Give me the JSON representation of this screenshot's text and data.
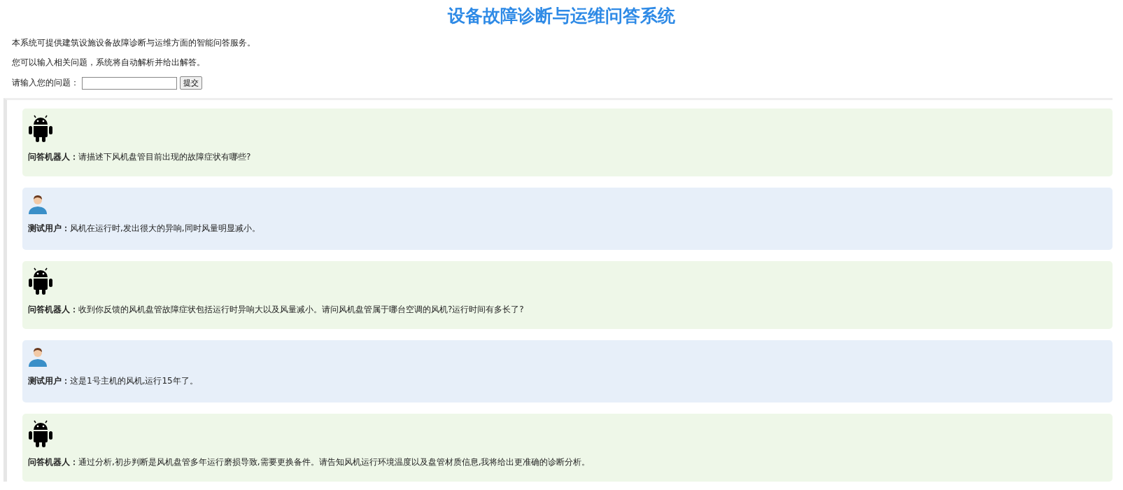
{
  "title": "设备故障诊断与运维问答系统",
  "intro": [
    "本系统可提供建筑设施设备故障诊断与运维方面的智能问答服务。",
    "您可以输入相关问题，系统将自动解析并给出解答。"
  ],
  "question_form": {
    "label": "请输入您的问题：",
    "submit": "提交"
  },
  "messages": [
    {
      "kind": "bot",
      "text": "**问答机器人：**请描述下风机盘管目前出现的故障症状有哪些?"
    },
    {
      "kind": "user",
      "text": "**测试用户：**风机在运行时,发出很大的异响,同时风量明显减小。"
    },
    {
      "kind": "bot",
      "text": "**问答机器人：**收到你反馈的风机盘管故障症状包括运行时异响大以及风量减小。请问风机盘管属于哪台空调的风机?运行时间有多长了?"
    },
    {
      "kind": "user",
      "text": "**测试用户：**这是1号主机的风机,运行15年了。"
    },
    {
      "kind": "bot",
      "text": "**问答机器人：**通过分析,初步判断是风机盘管多年运行磨损导致,需要更换备件。请告知风机运行环境温度以及盘管材质信息,我将给出更准确的诊断分析。"
    }
  ]
}
